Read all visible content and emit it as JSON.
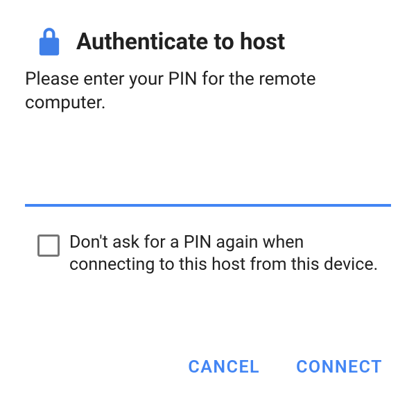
{
  "dialog": {
    "title": "Authenticate to host",
    "subtitle": "Please enter your PIN for the remote computer.",
    "pin_value": "",
    "checkbox_label": "Don't ask for a PIN again when connecting to this host from this device.",
    "cancel_label": "CANCEL",
    "connect_label": "CONNECT"
  },
  "icons": {
    "lock": "lock-icon"
  },
  "colors": {
    "accent": "#4285f4",
    "icon": "#3f7fe8",
    "text": "#212121",
    "checkbox_border": "#757575"
  }
}
